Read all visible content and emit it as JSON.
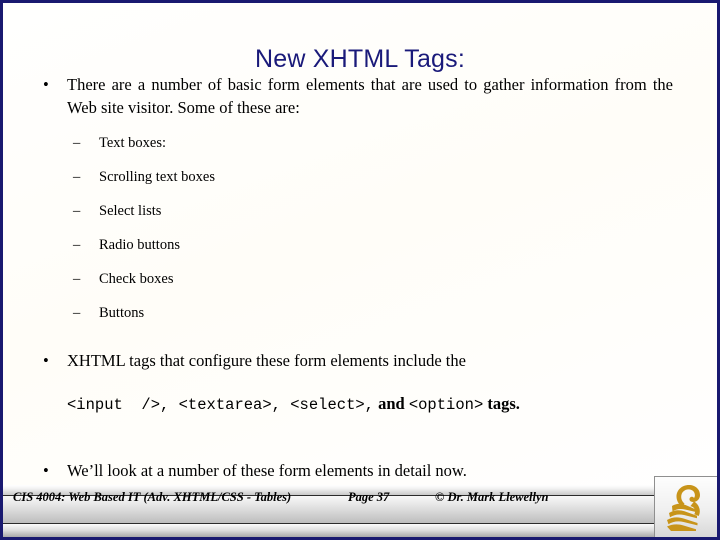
{
  "slide": {
    "title": "New XHTML Tags:",
    "title_color": "#1a1a7a",
    "border_color": "#191970",
    "background": "#ffffff"
  },
  "body": {
    "bullet_marker": "•",
    "dash_marker": "–",
    "bullets": [
      {
        "level": 1,
        "text": "There are a number of basic form elements that are used to gather information from the Web site visitor.  Some of these are:"
      },
      {
        "level": 2,
        "text": "Text boxes:"
      },
      {
        "level": 2,
        "text": "Scrolling text boxes"
      },
      {
        "level": 2,
        "text": "Select lists"
      },
      {
        "level": 2,
        "text": "Radio buttons"
      },
      {
        "level": 2,
        "text": "Check boxes"
      },
      {
        "level": 2,
        "text": "Buttons"
      },
      {
        "level": 1,
        "text": "XHTML tags that configure these form elements include the"
      },
      {
        "level": 1,
        "text": "We’ll look at a number of these form elements in detail now."
      }
    ],
    "code_line": {
      "input_tag": "<input  />,",
      "textarea_tag": " <textarea>,",
      "select_tag": " <select>,",
      "and_word": " and ",
      "option_tag": "<option>",
      "tail_word": " tags."
    }
  },
  "footer": {
    "course": "CIS 4004: Web Based IT (Adv. XHTML/CSS - Tables)",
    "page": "Page 37",
    "copyright": "© Dr. Mark Llewellyn",
    "logo_name": "ucf-pegasus-logo",
    "logo_color": "#c8941a"
  }
}
